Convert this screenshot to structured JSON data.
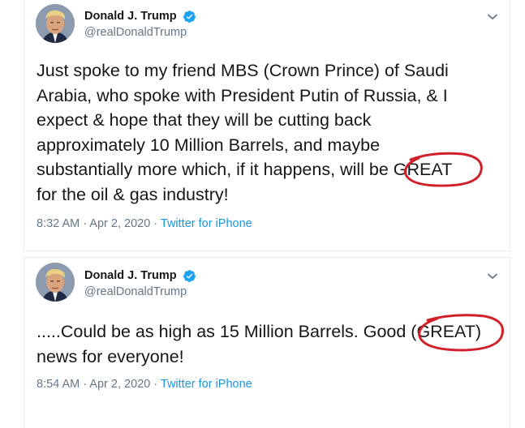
{
  "tweets": [
    {
      "author": {
        "name": "Donald J. Trump",
        "handle": "@realDonaldTrump"
      },
      "text": "Just spoke to my friend MBS (Crown Prince) of Saudi\nArabia, who spoke with President Putin of Russia, & I\nexpect & hope that they will be cutting back\napproximately 10 Million Barrels, and maybe\nsubstantially more which, if it happens, will be GREAT\nfor the oil & gas industry!",
      "time": "8:32 AM",
      "date": "Apr 2, 2020",
      "source": "Twitter for iPhone",
      "separator": " · "
    },
    {
      "author": {
        "name": "Donald J. Trump",
        "handle": "@realDonaldTrump"
      },
      "text": ".....Could be as high as 15 Million Barrels. Good (GREAT)\nnews for everyone!",
      "time": "8:54 AM",
      "date": "Apr 2, 2020",
      "source": "Twitter for iPhone",
      "separator": " · "
    }
  ],
  "colors": {
    "verified": "#1da1f2",
    "link": "#1b95e0",
    "secondary_text": "#657786",
    "annotation": "#d0202a"
  },
  "icons": {
    "verified": "verified-badge-icon",
    "chevron": "chevron-down-icon",
    "avatar": "profile-photo"
  }
}
